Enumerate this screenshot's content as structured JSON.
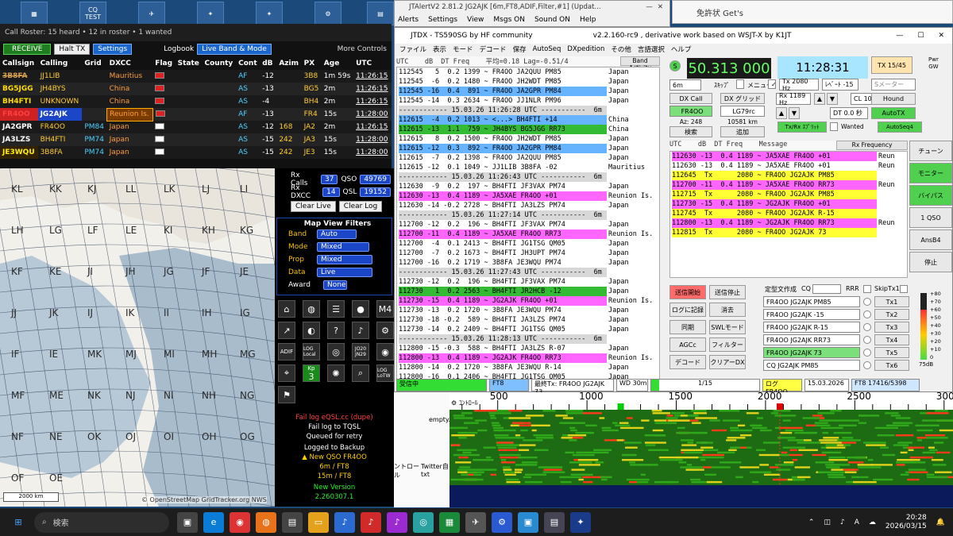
{
  "desktop": {
    "icons": [
      "",
      "CQ TEST",
      "",
      "",
      "",
      "",
      "",
      "",
      ""
    ]
  },
  "roster": {
    "title": "Call Roster: 15 heard • 12 in roster • 1 wanted",
    "receive_label": "RECEIVE",
    "halt_label": "Halt TX",
    "settings_label": "Settings",
    "logbook_label": "Logbook",
    "logbook_value": "Live Band & Mode",
    "more_controls": "More Controls",
    "columns": [
      "Callsign",
      "Calling",
      "Grid",
      "DXCC",
      "Flag",
      "State",
      "County",
      "Cont",
      "dB",
      "Azim",
      "PX",
      "Age",
      "UTC"
    ],
    "rows": [
      {
        "call": "3B8FA",
        "calling": "JJ1LIB",
        "grid": "",
        "dxcc": "Mauritius",
        "cont": "AF",
        "db": "-12",
        "azim": "",
        "px": "3B8",
        "age": "1m 59s",
        "utc": "11:26:15"
      },
      {
        "call": "BG5JGG",
        "calling": "JH4BYS",
        "grid": "",
        "dxcc": "China",
        "cont": "AS",
        "db": "-13",
        "azim": "",
        "px": "BG5",
        "age": "2m",
        "utc": "11:26:15"
      },
      {
        "call": "BH4FTI",
        "calling": "UNKNOWN",
        "grid": "",
        "dxcc": "China",
        "cont": "AS",
        "db": "-4",
        "azim": "",
        "px": "BH4",
        "age": "2m",
        "utc": "11:26:15"
      },
      {
        "call": "FR4OO",
        "calling": "JG2AJK",
        "grid": "",
        "dxcc": "Reunion Is.",
        "cont": "AF",
        "db": "-13",
        "azim": "",
        "px": "FR4",
        "age": "15s",
        "utc": "11:28:00"
      },
      {
        "call": "JA2GPR",
        "calling": "FR4OO",
        "grid": "PM84",
        "dxcc": "Japan",
        "cont": "AS",
        "db": "-12",
        "azim": "168",
        "px": "JA2",
        "age": "2m",
        "utc": "11:26:15"
      },
      {
        "call": "JA3LZS",
        "calling": "BH4FTI",
        "grid": "PM74",
        "dxcc": "Japan",
        "cont": "AS",
        "db": "-15",
        "azim": "242",
        "px": "JA3",
        "age": "15s",
        "utc": "11:28:00"
      },
      {
        "call": "JE3WQU",
        "calling": "3B8FA",
        "grid": "PM74",
        "dxcc": "Japan",
        "cont": "AS",
        "db": "-15",
        "azim": "242",
        "px": "JE3",
        "age": "15s",
        "utc": "11:28:00"
      }
    ]
  },
  "map": {
    "labels": [
      "KL",
      "KK",
      "KJ",
      "LL",
      "LK",
      "LJ",
      "LI",
      "LH",
      "LG",
      "LF",
      "LE",
      "KI",
      "KH",
      "KG",
      "KF",
      "KE",
      "JI",
      "JH",
      "JG",
      "JF",
      "JE",
      "JJ",
      "JK",
      "IJ",
      "IK",
      "II",
      "IH",
      "IG",
      "IF",
      "IE",
      "MK",
      "MJ",
      "MI",
      "MH",
      "MG",
      "MF",
      "ME",
      "NK",
      "NJ",
      "NI",
      "NH",
      "NG",
      "NF",
      "NE",
      "OK",
      "OJ",
      "OI",
      "OH",
      "OG",
      "OF",
      "OE"
    ],
    "scale": "2000 km",
    "credit": "© OpenStreetMap GridTracker.org NWS"
  },
  "stats": {
    "rx_calls_label": "Rx Calls",
    "rx_calls": "37",
    "qso_label": "QSO",
    "qso": "49769",
    "rx_dxcc_label": "Rx DXCC",
    "rx_dxcc": "14",
    "qsl_label": "QSL",
    "qsl": "19152",
    "clear_live": "Clear Live",
    "clear_log": "Clear Log"
  },
  "filters": {
    "title": "Map View Filters",
    "band_label": "Band",
    "band": "Auto",
    "mode_label": "Mode",
    "mode": "Mixed",
    "prop_label": "Prop",
    "prop": "Mixed",
    "data_label": "Data",
    "data": "Live",
    "award_label": "Award",
    "award": "None"
  },
  "tools": {
    "kp": "Kp",
    "kp_value": "3",
    "log_local": "LOG Local",
    "log_lotw": "LOG LoTW",
    "adif": "ADIF",
    "grid1": "JO20",
    "grid2": "JN29",
    "moon": "M",
    "num": "4"
  },
  "status": {
    "fail1": "Fail log eQSL.cc (dupe)",
    "fail2": "Fail log to TQSL",
    "queued": "Queued for retry",
    "backup": "Logged to Backup",
    "newqso": "▲ New QSO FR4OO",
    "band1": "6m / FT8",
    "band2": "15m / FT8",
    "newver": "New Version",
    "ver": "2.260307.1"
  },
  "jtalert": {
    "title": "JTAlertV2  2.81.2 JG2AJK [6m,FT8,ADIF,Filter,#1] (Updat...",
    "menu": [
      "Alerts",
      "Settings",
      "View",
      "Msgs ON",
      "Sound ON",
      "Help"
    ]
  },
  "certwin": {
    "title": "免許状 Get's"
  },
  "jtdx": {
    "title": "JTDX - TS590SG  by HF community",
    "subtitle": "v2.2.160-rc9 , derivative work based on WSJT-X by K1JT",
    "menu": [
      "ファイル",
      "表示",
      "モード",
      "デコード",
      "保存",
      "AutoSeq",
      "DXpedition",
      "その他",
      "言語選択",
      "ヘルプ"
    ],
    "band_header": "UTC    dB  DT Freq    平均=0.18 Lag=-0.51/4",
    "band_activity": "Band Activity",
    "rx_header": "UTC    dB  DT Freq    Message",
    "rx_frequency": "Rx Frequency",
    "band_rows": [
      {
        "t": "112545   5  0.2 1399 ~ FR4OO JA2QUU PM85",
        "c": "Japan",
        "bg": "#ffffff"
      },
      {
        "t": "112545  -6  0.2 1480 ~ FR4OO JH2WDT PM85",
        "c": "Japan",
        "bg": "#ffffff"
      },
      {
        "t": "112545 -16  0.4  891 ~ FR4OO JA2GPR PM84",
        "c": "Japan",
        "bg": "#66b3ff"
      },
      {
        "t": "112545 -14  0.3 2634 ~ FR4OO JJ1NLR PM96",
        "c": "Japan",
        "bg": "#ffffff"
      },
      {
        "t": "------------ 15.03.26 11:26:28 UTC -----------  6m -----",
        "c": "",
        "bg": "#d8d8d8"
      },
      {
        "t": "112615  -4  0.2 1013 ~ <...> BH4FTI +14",
        "c": "China",
        "bg": "#66b3ff"
      },
      {
        "t": "112615 -13  1.1  759 ~ JH4BYS BG5JGG RR73",
        "c": "China",
        "bg": "#33bb33"
      },
      {
        "t": "112615   8  0.2 1500 ~ FR4OO JH2WDT PM85",
        "c": "Japan",
        "bg": "#ffffff"
      },
      {
        "t": "112615 -12  0.3  892 ~ FR4OO JA2GPR PM84",
        "c": "Japan",
        "bg": "#66b3ff"
      },
      {
        "t": "112615  -7  0.2 1398 ~ FR4OO JA2QUU PM85",
        "c": "Japan",
        "bg": "#ffffff"
      },
      {
        "t": "112615 -12  0.1 1049 ~ JJ1LIB 3B8FA -02",
        "c": "Mauritius",
        "bg": "#ffffff"
      },
      {
        "t": "------------ 15.03.26 11:26:43 UTC -----------  6m -----",
        "c": "",
        "bg": "#d8d8d8"
      },
      {
        "t": "112630  -9  0.2  197 ~ BH4FTI JF3VAX PM74",
        "c": "Japan",
        "bg": "#ffffff"
      },
      {
        "t": "112630 -13  0.4 1189 ~ JA5XAE FR4OO +01",
        "c": "Reunion Is.",
        "bg": "#ff66ff"
      },
      {
        "t": "112630 -14 -0.2 2728 ~ BH4FTI JA3LZS PM74",
        "c": "Japan",
        "bg": "#ffffff"
      },
      {
        "t": "------------ 15.03.26 11:27:14 UTC -----------  6m -----",
        "c": "",
        "bg": "#d8d8d8"
      },
      {
        "t": "112700 -12  0.2  196 ~ BH4FTI JF3VAX PM74",
        "c": "Japan",
        "bg": "#ffffff"
      },
      {
        "t": "112700 -11  0.4 1189 ~ JA5XAE FR4OO RR73",
        "c": "Reunion Is.",
        "bg": "#ff66ff"
      },
      {
        "t": "112700  -4  0.1 2413 ~ BH4FTI JG1TSG QM05",
        "c": "Japan",
        "bg": "#ffffff"
      },
      {
        "t": "112700  -7  0.2 1673 ~ BH4FTI JH3UPT PM74",
        "c": "Japan",
        "bg": "#ffffff"
      },
      {
        "t": "112700 -16  0.2 1719 ~ 3B8FA JE3WQU PM74",
        "c": "Japan",
        "bg": "#ffffff"
      },
      {
        "t": "------------ 15.03.26 11:27:43 UTC -----------  6m -----",
        "c": "",
        "bg": "#d8d8d8"
      },
      {
        "t": "112730 -12  0.2  196 ~ BH4FTI JF3VAX PM74",
        "c": "Japan",
        "bg": "#ffffff"
      },
      {
        "t": "112730   1  0.2 2563 ~ BH4FTI JR2HCB -12",
        "c": "Japan",
        "bg": "#33bb33"
      },
      {
        "t": "112730 -15  0.4 1189 ~ JG2AJK FR4OO +01",
        "c": "Reunion Is.",
        "bg": "#ff66ff"
      },
      {
        "t": "112730 -13  0.2 1720 ~ 3B8FA JE3WQU PM74",
        "c": "Japan",
        "bg": "#ffffff"
      },
      {
        "t": "112730 -18 -0.2  589 ~ BH4FTI JA3LZS PM74",
        "c": "Japan",
        "bg": "#ffffff"
      },
      {
        "t": "112730 -14  0.2 2409 ~ BH4FTI JG1TSG QM05",
        "c": "Japan",
        "bg": "#ffffff"
      },
      {
        "t": "------------ 15.03.26 11:28:13 UTC -----------  6m -----",
        "c": "",
        "bg": "#d8d8d8"
      },
      {
        "t": "112800 -15 -0.3  588 ~ BH4FTI JA3LZS R-07",
        "c": "Japan",
        "bg": "#ffffff"
      },
      {
        "t": "112800 -13  0.4 1189 ~ JG2AJK FR4OO RR73",
        "c": "Reunion Is.",
        "bg": "#ff66ff"
      },
      {
        "t": "112800 -14  0.2 1720 ~ 3B8FA JE3WQU R-14",
        "c": "Japan",
        "bg": "#ffffff"
      },
      {
        "t": "112800 -16  0.1 2406 ~ BH4FTI JG1TSG QM05",
        "c": "Japan",
        "bg": "#ffffff"
      }
    ],
    "rx_rows": [
      {
        "t": "112630 -13  0.4 1189 ~ JA5XAE FR4OO +01",
        "c": "Reun",
        "bg": "#ff66ff"
      },
      {
        "t": "112630 -13  0.4 1189 ~ JA5XAE FR4OO +01",
        "c": "Reun",
        "bg": "#ffffff"
      },
      {
        "t": "112645  Tx      2080 ~ FR4OO JG2AJK PM85",
        "c": "",
        "bg": "#ffff33"
      },
      {
        "t": "112700 -11  0.4 1189 ~ JA5XAE FR4OO RR73",
        "c": "Reun",
        "bg": "#ff66ff"
      },
      {
        "t": "112715  Tx      2080 ~ FR4OO JG2AJK PM85",
        "c": "",
        "bg": "#ffff33"
      },
      {
        "t": "112730 -15  0.4 1189 ~ JG2AJK FR4OO +01",
        "c": "",
        "bg": "#ff66ff"
      },
      {
        "t": "112745  Tx      2080 ~ FR4OO JG2AJK R-15",
        "c": "",
        "bg": "#ffff33"
      },
      {
        "t": "112800 -13  0.4 1189 ~ JG2AJK FR4OO RR73",
        "c": "Reun",
        "bg": "#ff66ff"
      },
      {
        "t": "112815  Tx      2080 ~ FR4OO JG2AJK 73",
        "c": "",
        "bg": "#ffff33"
      }
    ],
    "band": "6m",
    "frequency": "50.313 000",
    "clock": "11:28:31",
    "tx_slot": "TX 15/45",
    "pwr_label": "Pwr",
    "pwr_unit": "GW",
    "s_label": "S",
    "skip": "ｽｷｯﾌﾟ",
    "memo": "メニュー",
    "tx_hz": "Tx 2080 Hz",
    "level": "ﾚﾍﾞｰﾄ -15",
    "smeter": "Sメーター",
    "dx_call_label": "DX Call",
    "dx_grid_label": "DX グリッド",
    "dx_call": "FR4OO",
    "dx_grid": "LG79rc",
    "az": "Az: 248",
    "dist": "10581 km",
    "search": "検索",
    "add": "追加",
    "rx_hz": "Rx 1189 Hz",
    "cl": "CL 100 %",
    "dt": "DT 0.0 秒",
    "hound": "Hound",
    "autotx": "AutoTX",
    "autoseq": "AutoSeq4",
    "txrx": "Tx/Rx ｽﾌﾟﾘｯﾄ",
    "wanted": "Wanted",
    "side_btns": [
      "チューン",
      "モニター",
      "バイパス",
      "1 QSO",
      "AnsB4",
      "停止"
    ],
    "ctrl": {
      "send": "送信開始",
      "stop": "送信停止",
      "log": "ログに記録",
      "clear": "消去",
      "sync": "同期",
      "swl": "SWLモード",
      "agc": "AGCc",
      "filter": "フィルター",
      "decode": "デコード",
      "cleardx": "クリアーDX"
    },
    "std_label": "定型文作成",
    "cq": "CQ",
    "rrr": "RRR",
    "skiptx1": "SkipTx1",
    "tx_msgs": [
      "FR4OO JG2AJK PM85",
      "FR4OO JG2AJK -15",
      "FR4OO JG2AJK R-15",
      "FR4OO JG2AJK RR73",
      "FR4OO JG2AJK 73",
      "CQ JG2AJK PM85"
    ],
    "tx_btns": [
      "Tx1",
      "Tx2",
      "Tx3",
      "Tx4",
      "Tx5",
      "Tx6"
    ],
    "meter_ticks": [
      "+80",
      "+70",
      "+60",
      "+50",
      "+40",
      "+30",
      "+20",
      "+10",
      "0"
    ],
    "db_val": "75dB",
    "statusbar": [
      "受信中",
      "FT8",
      "最終Tx: FR4OO JG2AJK 73",
      "WD 30m",
      "1/15",
      "ログ FR4OO",
      "15.03.2026",
      "FT8  17416/5398"
    ],
    "progress": 0.07
  },
  "waterfall": {
    "ticks": [
      "500",
      "1000",
      "1500",
      "2000",
      "2500",
      "3000"
    ],
    "tick_values": [
      500,
      1000,
      1500,
      2000,
      2500,
      3000
    ],
    "range": [
      230,
      3050
    ],
    "label": "ｺﾝﾄﾛｰﾙ"
  },
  "explorer": {
    "file1": "empty.t",
    "file2": "ントロー\nル",
    "file3": "Twitter自己\ntxt"
  },
  "taskbar": {
    "search": "検索",
    "time": "20:28",
    "date": "2026/03/15",
    "lang": "A"
  }
}
